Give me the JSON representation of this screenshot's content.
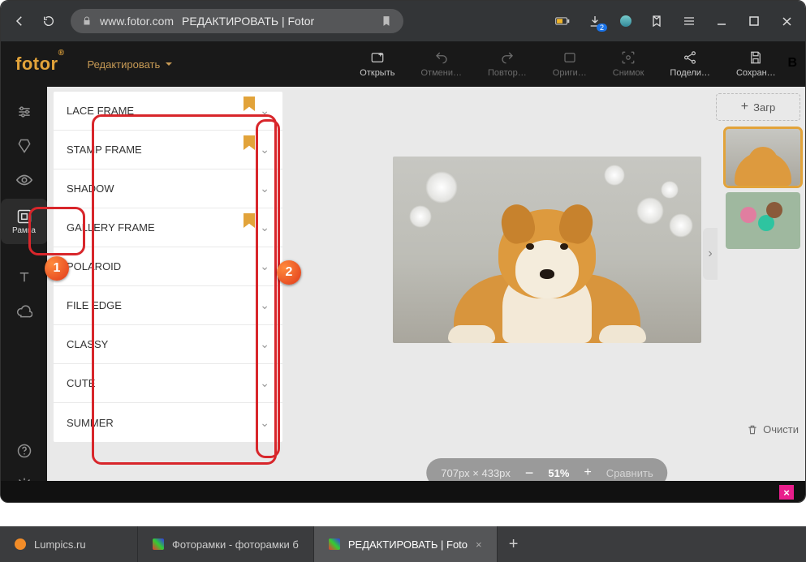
{
  "browser": {
    "host": "www.fotor.com",
    "title": "РЕДАКТИРОВАТЬ | Fotor",
    "download_badge": "2"
  },
  "app": {
    "logo": "fotor",
    "edit_dropdown": "Редактировать",
    "b_label": "B"
  },
  "top_actions": {
    "open": "Открыть",
    "undo": "Отмени…",
    "redo": "Повтор…",
    "original": "Ориги…",
    "snapshot": "Снимок",
    "share": "Подели…",
    "save": "Сохран…"
  },
  "rail": {
    "frame_label": "Рамка"
  },
  "frames": [
    {
      "label": "LACE FRAME",
      "bookmark": true
    },
    {
      "label": "STAMP FRAME",
      "bookmark": true
    },
    {
      "label": "SHADOW",
      "bookmark": false
    },
    {
      "label": "GALLERY FRAME",
      "bookmark": true
    },
    {
      "label": "POLAROID",
      "bookmark": false
    },
    {
      "label": "FILE EDGE",
      "bookmark": false
    },
    {
      "label": "CLASSY",
      "bookmark": false
    },
    {
      "label": "CUTE",
      "bookmark": false
    },
    {
      "label": "SUMMER",
      "bookmark": false
    }
  ],
  "canvas": {
    "dimensions": "707px × 433px",
    "minus": "−",
    "zoom": "51%",
    "plus": "+",
    "compare": "Сравнить"
  },
  "right": {
    "load": "Загр",
    "clear": "Очисти"
  },
  "tabs": {
    "t1": "Lumpics.ru",
    "t2": "Фоторамки - фоторамки б",
    "t3": "РЕДАКТИРОВАТЬ | Foto"
  },
  "callouts": {
    "one": "1",
    "two": "2"
  }
}
